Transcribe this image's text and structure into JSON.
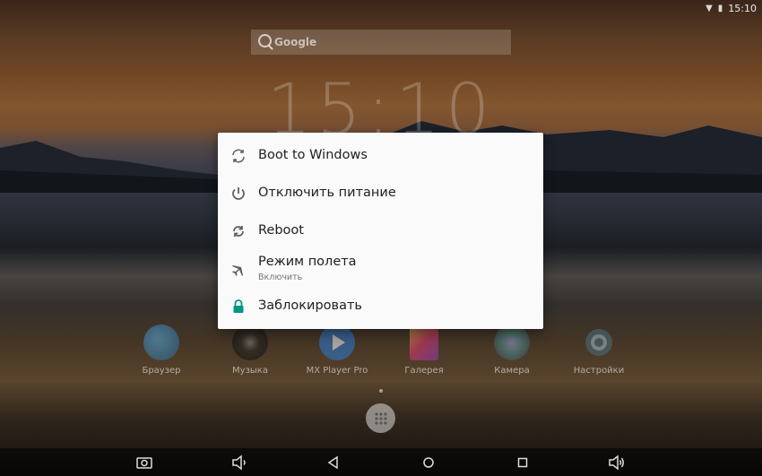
{
  "status_bar": {
    "time": "15:10"
  },
  "search": {
    "label": "Google"
  },
  "clock": {
    "time": "15:10"
  },
  "apps": [
    {
      "label": "Браузер",
      "color": "#2a7fbf"
    },
    {
      "label": "Музыка",
      "color": "#333333"
    },
    {
      "label": "MX Player Pro",
      "color": "#2e7bd6"
    },
    {
      "label": "Галерея",
      "color": "#c4397a"
    },
    {
      "label": "Камера",
      "color": "#4b8a8a"
    },
    {
      "label": "Настройки",
      "color": "#4a6a7a"
    }
  ],
  "power_menu": {
    "items": [
      {
        "label": "Boot to Windows",
        "icon": "boot-windows-icon"
      },
      {
        "label": "Отключить питание",
        "icon": "power-icon"
      },
      {
        "label": "Reboot",
        "icon": "reboot-icon"
      },
      {
        "label": "Режим полета",
        "sublabel": "Включить",
        "icon": "airplane-icon"
      },
      {
        "label": "Заблокировать",
        "icon": "lock-icon"
      }
    ],
    "accent": "#009688"
  }
}
